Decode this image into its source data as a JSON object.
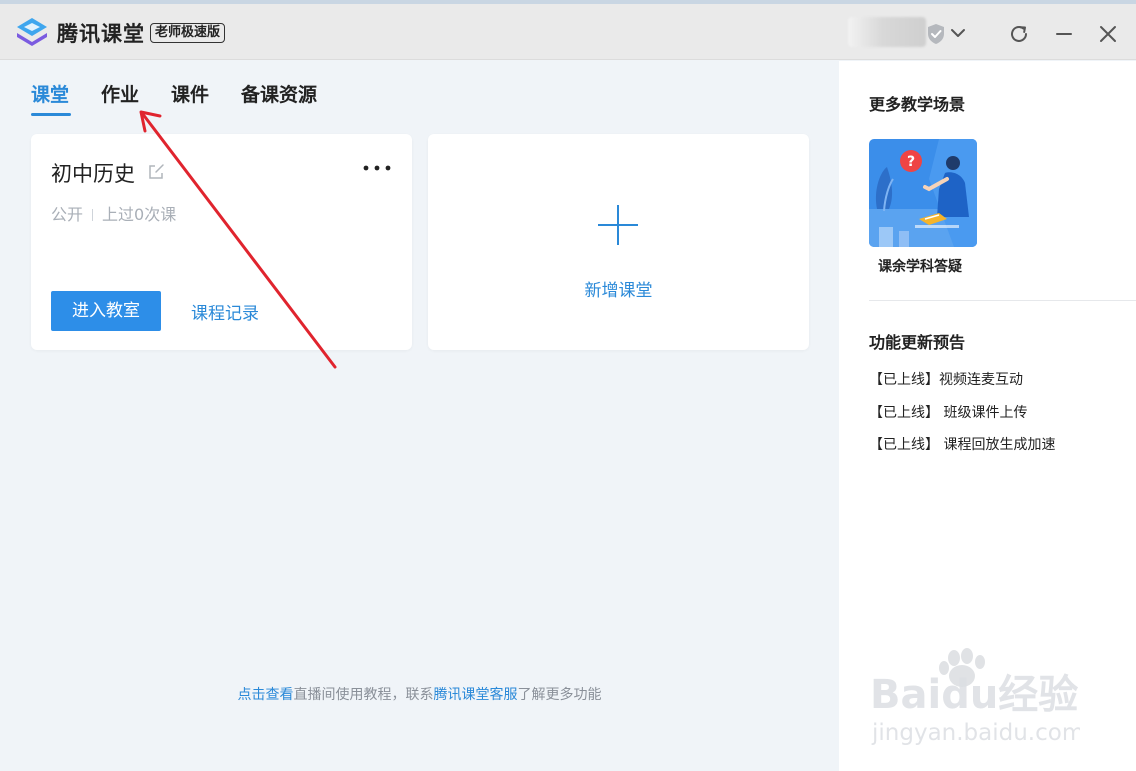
{
  "app": {
    "title": "腾讯课堂",
    "edition": "老师极速版"
  },
  "tabs": [
    {
      "label": "课堂",
      "active": true
    },
    {
      "label": "作业",
      "active": false
    },
    {
      "label": "课件",
      "active": false
    },
    {
      "label": "备课资源",
      "active": false
    }
  ],
  "course_card": {
    "name": "初中历史",
    "visibility": "公开",
    "sessions": "上过0次课",
    "enter_button": "进入教室",
    "record_link": "课程记录"
  },
  "add_card": {
    "label": "新增课堂"
  },
  "footer": {
    "link1": "点击查看",
    "text1": "直播间使用教程，联系",
    "link2": "腾讯课堂客服",
    "text2": "了解更多功能"
  },
  "sidebar": {
    "scenes_heading": "更多教学场景",
    "scene_label": "课余学科答疑",
    "updates_heading": "功能更新预告",
    "updates": [
      "【已上线】视频连麦互动",
      "【已上线】 班级课件上传",
      "【已上线】 课程回放生成加速"
    ]
  },
  "icons": {
    "logo": "tencent-classroom-logo",
    "shield": "shield-check-icon",
    "chevron": "chevron-down-icon",
    "refresh": "refresh-icon",
    "minimize": "minimize-icon",
    "close": "close-icon",
    "edit": "edit-icon",
    "more": "more-icon",
    "plus": "plus-icon"
  },
  "watermark": {
    "brand": "Baidu经验",
    "url": "jingyan.baidu.com"
  },
  "colors": {
    "accent": "#2a89d8",
    "button": "#2d8ee8",
    "annotation_arrow": "#e0242e"
  }
}
